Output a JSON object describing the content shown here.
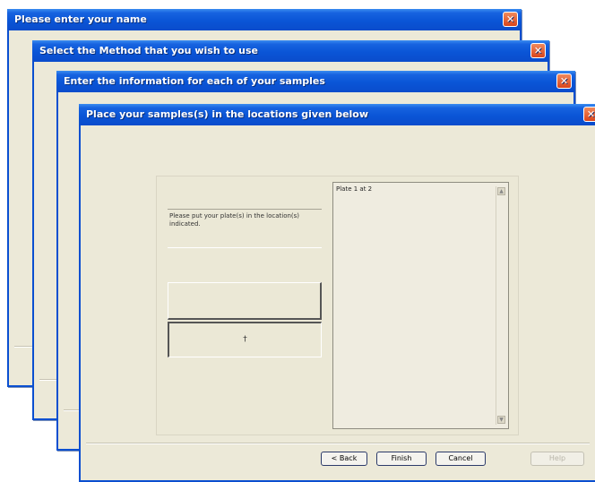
{
  "windows": [
    {
      "title": "Please enter your name"
    },
    {
      "title": "Select the Method that you wish to use"
    },
    {
      "title": "Enter the information for each of your samples"
    },
    {
      "title": "Place your samples(s) in the locations given below"
    }
  ],
  "close_glyph": "✕",
  "main": {
    "instruction": "Please put your plate(s) in the location(s) indicated.",
    "slot_marker": "†",
    "list_items": [
      "Plate 1 at 2"
    ],
    "scroll_up_glyph": "▲",
    "scroll_down_glyph": "▼"
  },
  "buttons": {
    "back": "< Back",
    "finish": "Finish",
    "cancel": "Cancel",
    "help": "Help"
  }
}
